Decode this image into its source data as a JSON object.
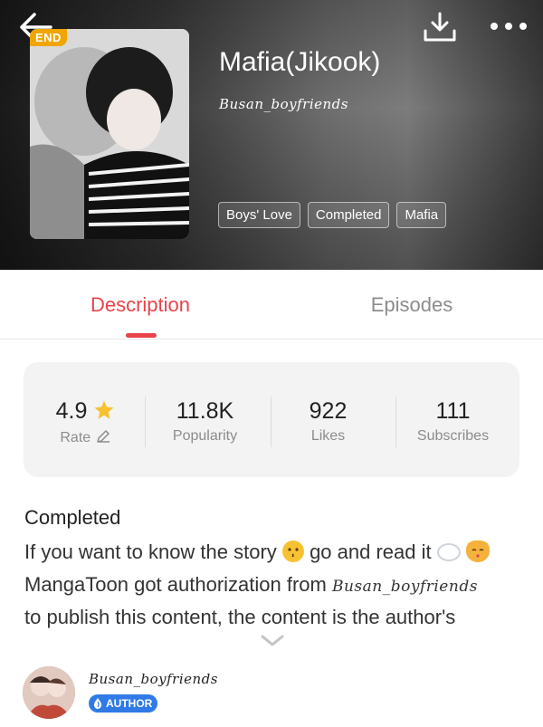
{
  "header": {
    "badge": "END",
    "title": "Mafia(Jikook)",
    "author": "Busan_boyfriends",
    "tags": [
      "Boys' Love",
      "Completed",
      "Mafia"
    ]
  },
  "tabs": [
    {
      "label": "Description",
      "active": true
    },
    {
      "label": "Episodes",
      "active": false
    }
  ],
  "stats": [
    {
      "value": "4.9",
      "label": "Rate"
    },
    {
      "value": "11.8K",
      "label": "Popularity"
    },
    {
      "value": "922",
      "label": "Likes"
    },
    {
      "value": "111",
      "label": "Subscribes"
    }
  ],
  "description": {
    "status": "Completed",
    "line1_a": "If you want to know the story",
    "line1_b": " go and read it",
    "line2_a": "MangaToon got authorization from ",
    "line2_author": "Busan_boyfriends",
    "line3": "to publish this content, the content is the author's"
  },
  "author": {
    "name": "Busan_boyfriends",
    "badge": "AUTHOR"
  },
  "colors": {
    "accent": "#e8434a",
    "end_badge": "#f0a500",
    "author_badge": "#2f7ae5",
    "star": "#f6c232"
  }
}
